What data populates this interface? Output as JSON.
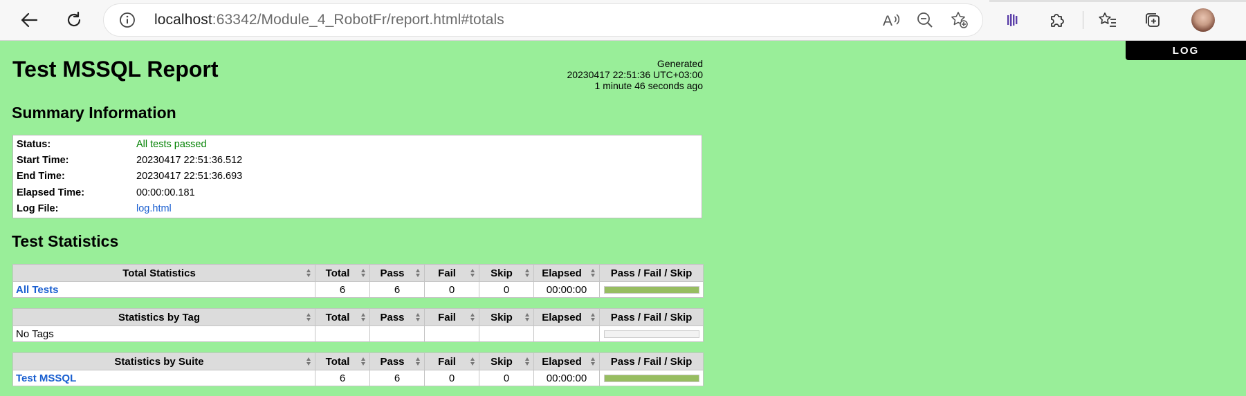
{
  "browser": {
    "url_host": "localhost",
    "url_path": ":63342/Module_4_RobotFr/report.html#totals",
    "icons": [
      "back-icon",
      "refresh-icon",
      "info-icon",
      "read-aloud-icon",
      "zoom-out-icon",
      "favorite-add-icon",
      "extension-icon",
      "puzzle-icon",
      "favorites-icon",
      "collections-icon",
      "profile-avatar"
    ]
  },
  "log_button": "LOG",
  "report": {
    "title": "Test MSSQL Report",
    "generated_label": "Generated",
    "generated_time": "20230417 22:51:36 UTC+03:00",
    "generated_ago": "1 minute 46 seconds ago"
  },
  "summary": {
    "heading": "Summary Information",
    "rows": [
      {
        "label": "Status:",
        "value": "All tests passed"
      },
      {
        "label": "Start Time:",
        "value": "20230417 22:51:36.512"
      },
      {
        "label": "End Time:",
        "value": "20230417 22:51:36.693"
      },
      {
        "label": "Elapsed Time:",
        "value": "00:00:00.181"
      },
      {
        "label": "Log File:",
        "value": "log.html"
      }
    ]
  },
  "statistics": {
    "heading": "Test Statistics",
    "columns": [
      "Total",
      "Pass",
      "Fail",
      "Skip",
      "Elapsed",
      "Pass / Fail / Skip"
    ],
    "tables": [
      {
        "header": "Total Statistics",
        "row": {
          "name": "All Tests",
          "total": "6",
          "pass": "6",
          "fail": "0",
          "skip": "0",
          "elapsed": "00:00:00",
          "pass_fraction": 1.0
        }
      },
      {
        "header": "Statistics by Tag",
        "row": {
          "name": "No Tags",
          "total": "",
          "pass": "",
          "fail": "",
          "skip": "",
          "elapsed": "",
          "pass_fraction": 0
        }
      },
      {
        "header": "Statistics by Suite",
        "row": {
          "name": "Test MSSQL",
          "total": "6",
          "pass": "6",
          "fail": "0",
          "skip": "0",
          "elapsed": "00:00:00",
          "pass_fraction": 1.0
        }
      }
    ]
  },
  "colors": {
    "background": "#99ee99",
    "pass": "#008000",
    "link": "#1a5fd0",
    "graph_pass": "#97bd61"
  }
}
